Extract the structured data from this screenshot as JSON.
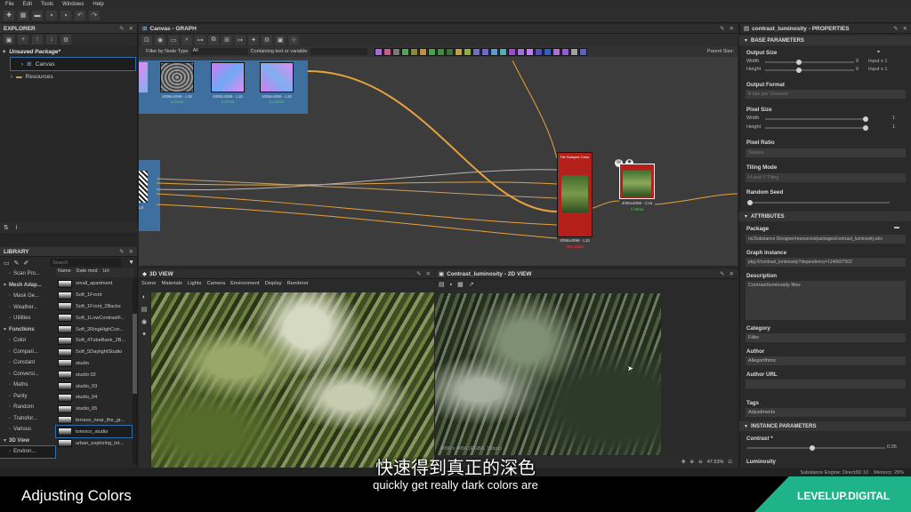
{
  "menu": [
    "File",
    "Edit",
    "Tools",
    "Windows",
    "Help"
  ],
  "explorer": {
    "title": "EXPLORER",
    "package": "Unsaved Package*",
    "canvas": "Canvas",
    "resources": "Resources"
  },
  "graph": {
    "title": "Canvas - GRAPH",
    "filter_label": "Filter by Node Type",
    "filter_value": "All",
    "containing_label": "Containing text or variable",
    "parent_size": "Parent Size:",
    "nodes": {
      "n1_res": "4096x4096 - L16",
      "n1_time": "6.61ms",
      "n2_res": "4096x4096 - L16",
      "n2_time": "1.87ms",
      "n3_res": "4096x4096 - L16",
      "n3_time": "11.24ms",
      "left_res": "L8",
      "sampler_title": "Tile Sampler Color",
      "sampler_res": "4096x4096 - L16",
      "sampler_time": "301.11ms",
      "contrast_res": "4096x4096 - C16",
      "contrast_time": "7.43ms"
    }
  },
  "library": {
    "title": "LIBRARY",
    "search_placeholder": "Search",
    "columns": [
      "Name",
      "Date mod",
      "Url"
    ],
    "categories": [
      {
        "label": "Scan Pro...",
        "indent": 1
      },
      {
        "label": "Mesh Adap...",
        "indent": 0,
        "bold": true
      },
      {
        "label": "Mask Ge...",
        "indent": 1
      },
      {
        "label": "Weather...",
        "indent": 1
      },
      {
        "label": "Utilities",
        "indent": 1
      },
      {
        "label": "Functions",
        "indent": 0,
        "bold": true
      },
      {
        "label": "Color",
        "indent": 1
      },
      {
        "label": "Compari...",
        "indent": 1
      },
      {
        "label": "Constant",
        "indent": 1
      },
      {
        "label": "Conversi...",
        "indent": 1
      },
      {
        "label": "Maths",
        "indent": 1
      },
      {
        "label": "Parity",
        "indent": 1
      },
      {
        "label": "Random",
        "indent": 1
      },
      {
        "label": "Transfor...",
        "indent": 1
      },
      {
        "label": "Various",
        "indent": 1
      },
      {
        "label": "3D View",
        "indent": 0,
        "bold": true
      },
      {
        "label": "Environ...",
        "indent": 1,
        "selected": true
      }
    ],
    "items": [
      "small_apartment",
      "Soft_1Front",
      "Soft_1Front_2Backs",
      "Soft_1LowContrastF...",
      "Soft_2RingHighCon...",
      "Soft_4TubeBank_2B...",
      "Soft_5DaylightStudio",
      "studio",
      "studio 02",
      "studio_03",
      "studio_04",
      "studio_05",
      "terrace_near_the_gr...",
      "tomoco_studio",
      "urban_exploring_int..."
    ],
    "selected_item": "tomoco_studio"
  },
  "view3d": {
    "title": "3D VIEW",
    "menu": [
      "Scene",
      "Materials",
      "Lights",
      "Camera",
      "Environment",
      "Display",
      "Renderer"
    ]
  },
  "view2d": {
    "title": "Contrast_luminosity - 2D VIEW",
    "resolution": "4096 x 4096 (RGBA, 16bpc)",
    "zoom": "47.53%"
  },
  "properties": {
    "title": "contrast_luminosity - PROPERTIES",
    "base_parameters": "BASE PARAMETERS",
    "output_size": "Output Size",
    "width_label": "Width",
    "height_label": "Height",
    "width_value": "0",
    "height_value": "0",
    "width_mode": "Input x 1",
    "height_mode": "Input x 1",
    "output_format": "Output Format",
    "output_format_value": "8 bits per Channel",
    "pixel_size": "Pixel Size",
    "ps_width_value": "1",
    "ps_height_value": "1",
    "pixel_ratio": "Pixel Ratio",
    "pixel_ratio_value": "Square",
    "tiling_mode": "Tiling Mode",
    "tiling_mode_value": "H and V Tiling",
    "random_seed": "Random Seed",
    "attributes": "ATTRIBUTES",
    "package_label": "Package",
    "package_value": "nc/Substance Designer/resources/packages/contrast_luminosity.sbs",
    "graph_instance_label": "Graph instance",
    "graph_instance_value": "pkg:///contrast_luminosity?dependency=1146607502",
    "description_label": "Description",
    "description_value": "Contrast/luminosity filter.",
    "category_label": "Category",
    "category_value": "Filter",
    "author_label": "Author",
    "author_value": "Allegorithmic",
    "author_url_label": "Author URL",
    "tags_label": "Tags",
    "tags_value": "Adjustments",
    "instance_parameters": "INSTANCE PARAMETERS",
    "contrast_label": "Contrast *",
    "contrast_value": "0.05",
    "luminosity_label": "Luminosity"
  },
  "statusbar": {
    "engine": "Substance Engine: Direct3D 10",
    "memory": "Memory: 29%"
  },
  "subtitles": {
    "chinese": "快速得到真正的深色",
    "english": "quickly get really dark colors are"
  },
  "footer": {
    "lesson": "Adjusting Colors",
    "brand": "LEVELUP.DIGITAL"
  },
  "colors": {
    "accent_blue": "#3f7fc0",
    "node_red": "#b3201b",
    "wire_orange": "#e6a23c",
    "brand_green": "#1fb38a"
  }
}
